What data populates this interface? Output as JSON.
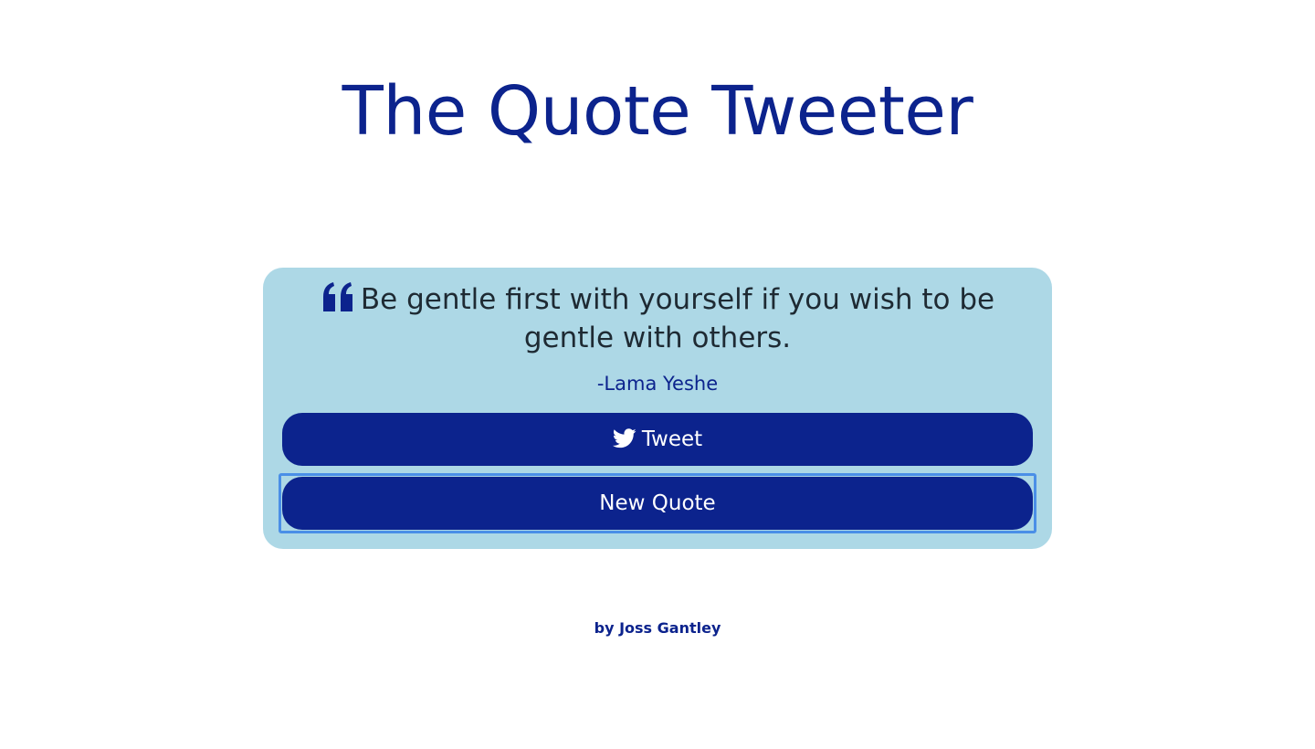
{
  "header": {
    "title": "The Quote Tweeter"
  },
  "quote": {
    "icon": "quote-left-icon",
    "text": "Be gentle first with yourself if you wish to be gentle with others.",
    "author": "-Lama Yeshe"
  },
  "buttons": {
    "tweet_icon": "twitter-icon",
    "tweet_label": "Tweet",
    "new_quote_label": "New Quote",
    "focused": "new_quote"
  },
  "footer": {
    "credit": "by Joss Gantley"
  },
  "colors": {
    "primary": "#0c238d",
    "card_background": "#add8e6",
    "quote_text": "#1e2a33",
    "focus_ring": "#4a8fe7",
    "page_background": "#ffffff"
  }
}
